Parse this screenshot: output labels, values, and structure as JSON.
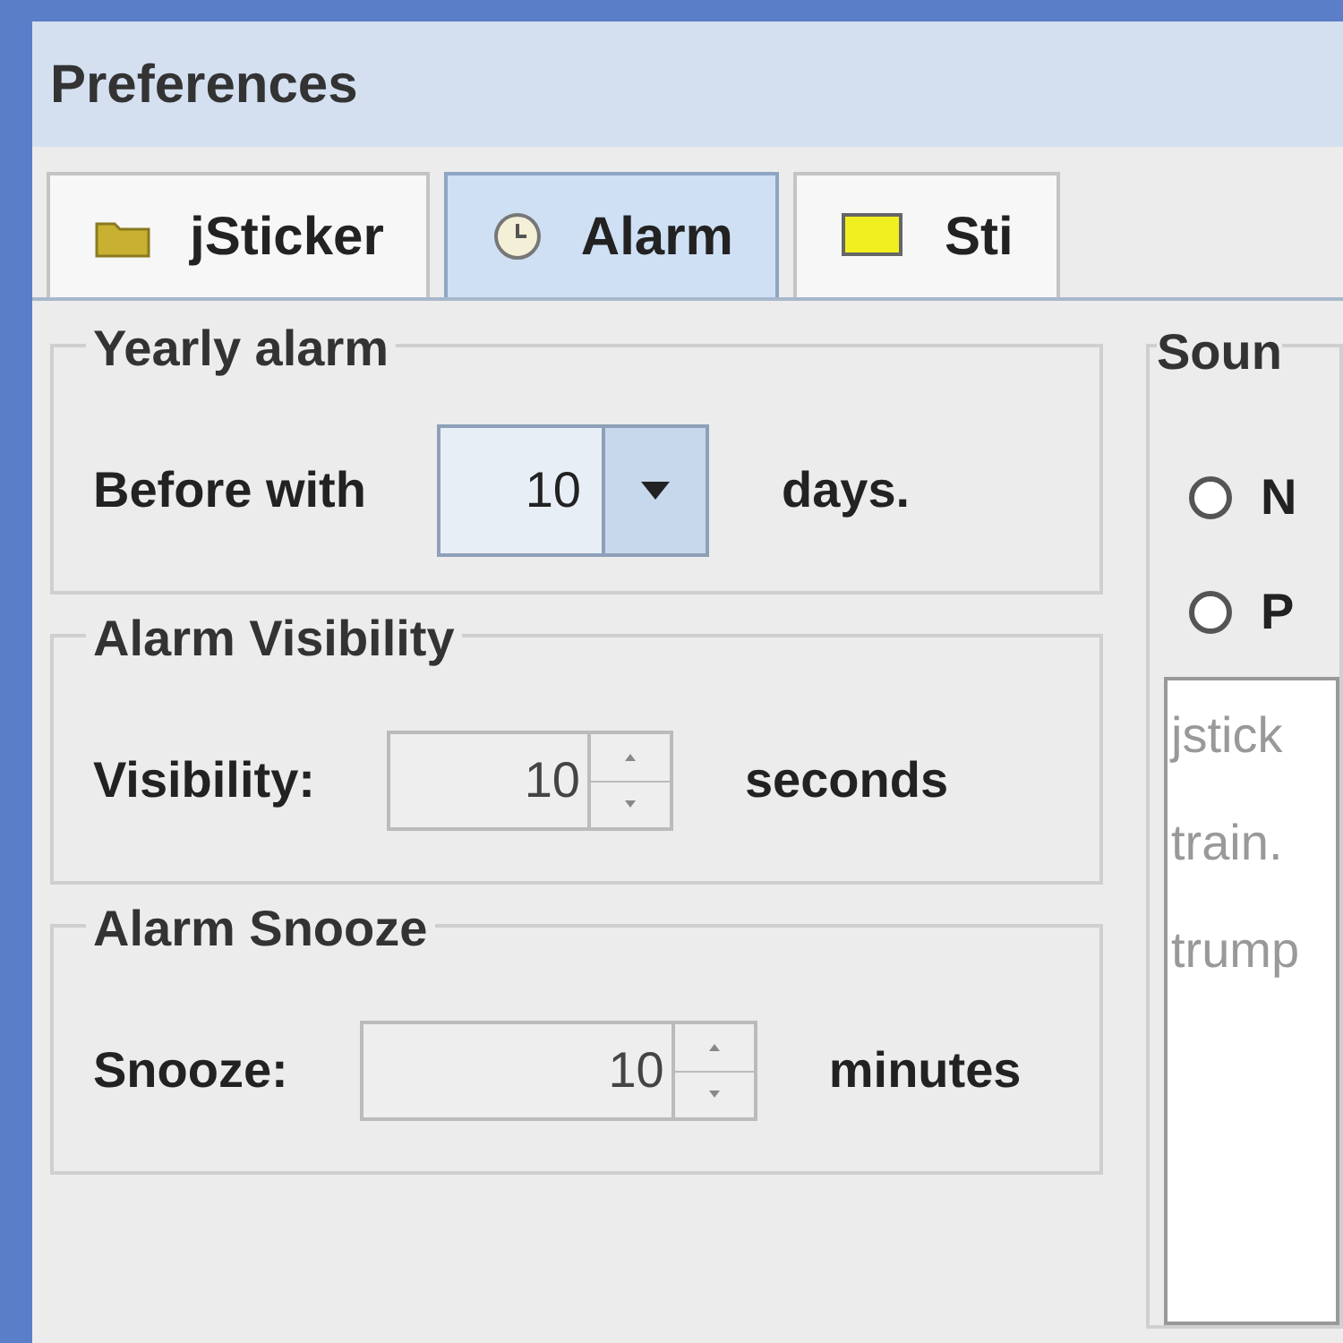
{
  "window": {
    "title": "Preferences"
  },
  "tabs": [
    {
      "label": "jSticker",
      "selected": false
    },
    {
      "label": "Alarm",
      "selected": true
    },
    {
      "label": "Sti",
      "selected": false
    }
  ],
  "groups": [
    {
      "title": "Yearly alarm",
      "label": "Before with",
      "kind": "dropdown",
      "value": "10",
      "unit": "days."
    },
    {
      "title": "Alarm Visibility",
      "label": "Visibility:",
      "kind": "spinner",
      "value": "10",
      "unit": "seconds"
    },
    {
      "title": "Alarm Snooze",
      "label": "Snooze:",
      "kind": "spinner",
      "value": "10",
      "unit": "minutes"
    }
  ],
  "sound": {
    "title": "Soun",
    "options": [
      {
        "label": "N",
        "selected": false
      },
      {
        "label": "P",
        "selected": false
      }
    ],
    "files": [
      "jstick",
      "train.",
      "trump"
    ]
  }
}
